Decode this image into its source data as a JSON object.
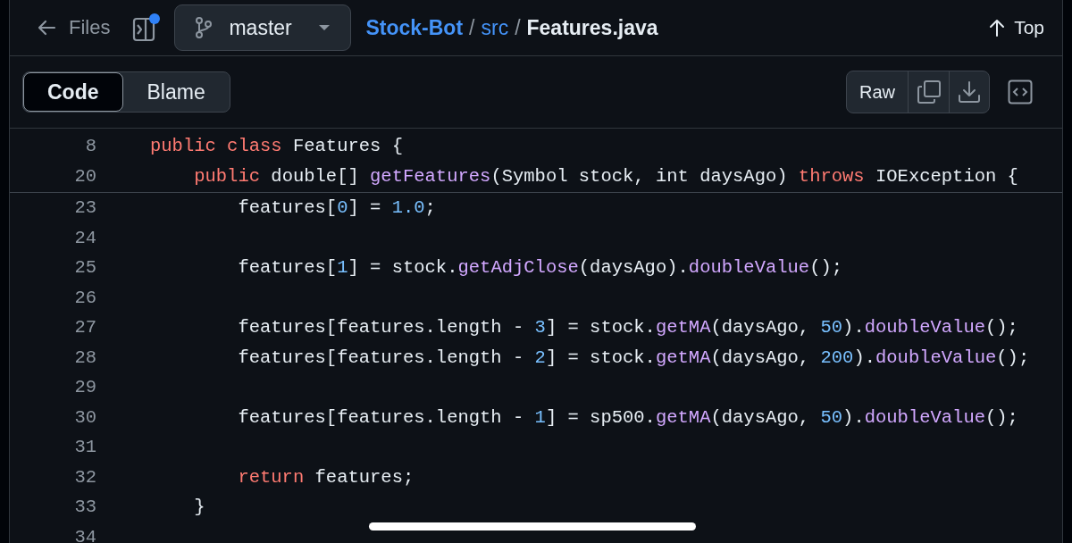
{
  "header": {
    "back_label": "Files",
    "branch": "master",
    "path_separator": "/",
    "breadcrumb": [
      {
        "text": "Stock-Bot",
        "kind": "link"
      },
      {
        "text": "src",
        "kind": "link"
      },
      {
        "text": "Features.java",
        "kind": "current"
      }
    ],
    "top_label": "Top"
  },
  "view_tabs": [
    {
      "label": "Code",
      "selected": true
    },
    {
      "label": "Blame",
      "selected": false
    }
  ],
  "actions": {
    "raw_label": "Raw"
  },
  "sticky_lines": [
    {
      "number": "8",
      "tokens": [
        {
          "text": "public class",
          "kind": "keyword"
        },
        {
          "text": " Features {",
          "kind": "plain"
        }
      ]
    },
    {
      "number": "20",
      "tokens": [
        {
          "text": "    public",
          "kind": "keyword"
        },
        {
          "text": " double[] ",
          "kind": "plain"
        },
        {
          "text": "getFeatures",
          "kind": "function"
        },
        {
          "text": "(Symbol stock, int daysAgo) ",
          "kind": "plain"
        },
        {
          "text": "throws",
          "kind": "keyword"
        },
        {
          "text": " IOException {",
          "kind": "plain"
        }
      ]
    }
  ],
  "lines": [
    {
      "number": "23",
      "tokens": [
        {
          "text": "        features[",
          "kind": "plain"
        },
        {
          "text": "0",
          "kind": "number"
        },
        {
          "text": "] = ",
          "kind": "plain"
        },
        {
          "text": "1.0",
          "kind": "number"
        },
        {
          "text": ";",
          "kind": "plain"
        }
      ]
    },
    {
      "number": "24"
    },
    {
      "number": "25",
      "tokens": [
        {
          "text": "        features[",
          "kind": "plain"
        },
        {
          "text": "1",
          "kind": "number"
        },
        {
          "text": "] = stock.",
          "kind": "plain"
        },
        {
          "text": "getAdjClose",
          "kind": "function"
        },
        {
          "text": "(daysAgo).",
          "kind": "plain"
        },
        {
          "text": "doubleValue",
          "kind": "function"
        },
        {
          "text": "();",
          "kind": "plain"
        }
      ]
    },
    {
      "number": "26"
    },
    {
      "number": "27",
      "tokens": [
        {
          "text": "        features[features.length - ",
          "kind": "plain"
        },
        {
          "text": "3",
          "kind": "number"
        },
        {
          "text": "] = stock.",
          "kind": "plain"
        },
        {
          "text": "getMA",
          "kind": "function"
        },
        {
          "text": "(daysAgo, ",
          "kind": "plain"
        },
        {
          "text": "50",
          "kind": "number"
        },
        {
          "text": ").",
          "kind": "plain"
        },
        {
          "text": "doubleValue",
          "kind": "function"
        },
        {
          "text": "();",
          "kind": "plain"
        }
      ]
    },
    {
      "number": "28",
      "tokens": [
        {
          "text": "        features[features.length - ",
          "kind": "plain"
        },
        {
          "text": "2",
          "kind": "number"
        },
        {
          "text": "] = stock.",
          "kind": "plain"
        },
        {
          "text": "getMA",
          "kind": "function"
        },
        {
          "text": "(daysAgo, ",
          "kind": "plain"
        },
        {
          "text": "200",
          "kind": "number"
        },
        {
          "text": ").",
          "kind": "plain"
        },
        {
          "text": "doubleValue",
          "kind": "function"
        },
        {
          "text": "();",
          "kind": "plain"
        }
      ]
    },
    {
      "number": "29"
    },
    {
      "number": "30",
      "tokens": [
        {
          "text": "        features[features.length - ",
          "kind": "plain"
        },
        {
          "text": "1",
          "kind": "number"
        },
        {
          "text": "] = sp500.",
          "kind": "plain"
        },
        {
          "text": "getMA",
          "kind": "function"
        },
        {
          "text": "(daysAgo, ",
          "kind": "plain"
        },
        {
          "text": "50",
          "kind": "number"
        },
        {
          "text": ").",
          "kind": "plain"
        },
        {
          "text": "doubleValue",
          "kind": "function"
        },
        {
          "text": "();",
          "kind": "plain"
        }
      ]
    },
    {
      "number": "31"
    },
    {
      "number": "32",
      "tokens": [
        {
          "text": "        return",
          "kind": "keyword"
        },
        {
          "text": " features;",
          "kind": "plain"
        }
      ]
    },
    {
      "number": "33",
      "tokens": [
        {
          "text": "    }",
          "kind": "plain"
        }
      ]
    },
    {
      "number": "34"
    }
  ]
}
